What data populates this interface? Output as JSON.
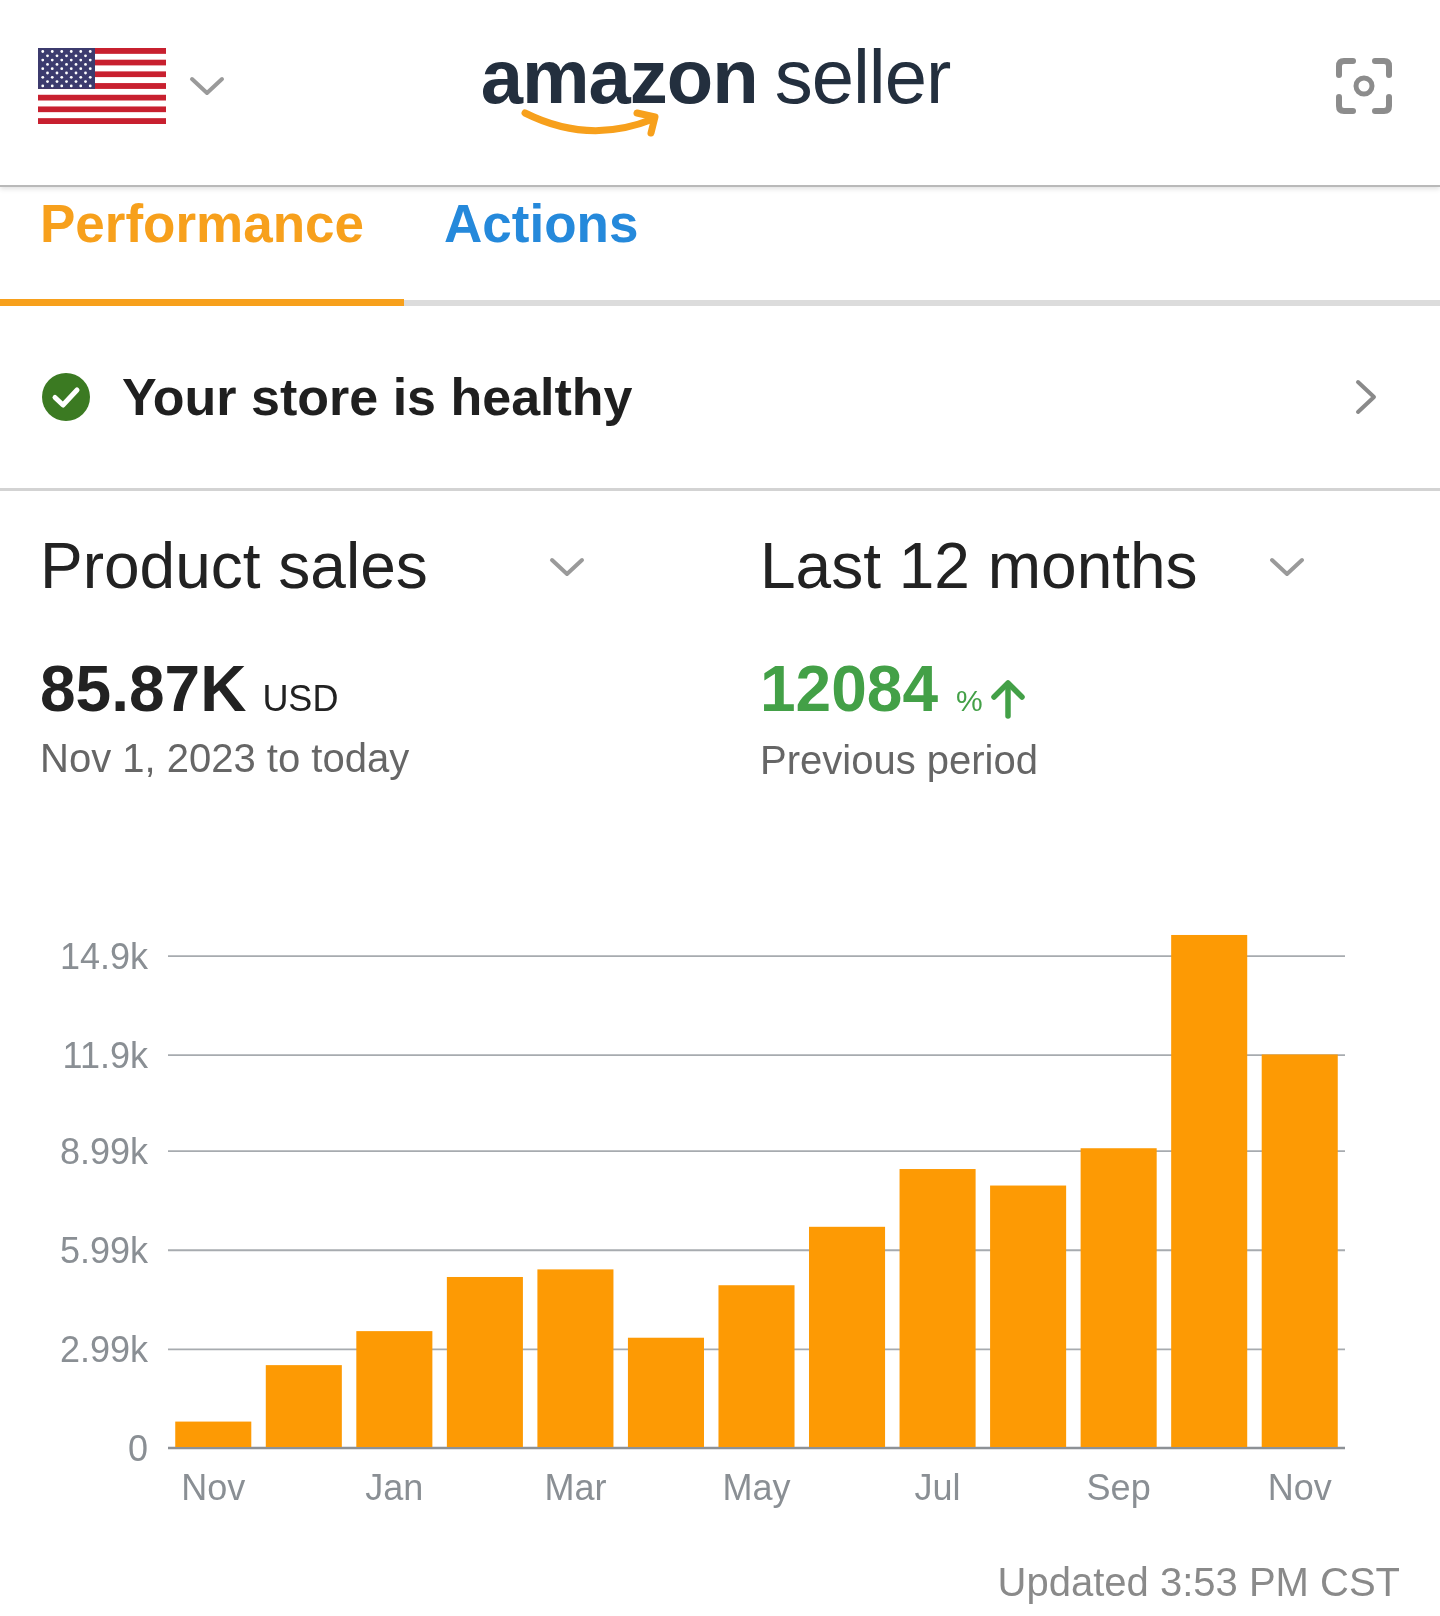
{
  "header": {
    "logo": {
      "brand": "amazon",
      "product": "seller"
    }
  },
  "tabs": [
    {
      "label": "Performance",
      "selected": true
    },
    {
      "label": "Actions",
      "selected": false
    }
  ],
  "store_status": {
    "text": "Your store is healthy",
    "healthy": true
  },
  "metric_selector": {
    "label": "Product sales"
  },
  "period_selector": {
    "label": "Last 12 months"
  },
  "summary": {
    "value": "85.87K",
    "unit": "USD",
    "range": "Nov 1, 2023 to today"
  },
  "comparison": {
    "value": "12084",
    "unit": "%",
    "increase": true,
    "caption": "Previous period"
  },
  "chart": {
    "chart_data": {
      "type": "bar",
      "categories": [
        "Nov",
        null,
        "Jan",
        null,
        "Mar",
        null,
        "May",
        null,
        "Jul",
        null,
        "Sep",
        null,
        "Nov"
      ],
      "values": [
        770,
        2480,
        3510,
        5150,
        5380,
        3310,
        4900,
        6670,
        8420,
        7920,
        9050,
        15510,
        11890
      ],
      "ylim": [
        0,
        15600
      ],
      "yticks": [
        0,
        {
          "value": 2990,
          "label": "2.99k"
        },
        {
          "value": 5990,
          "label": "5.99k"
        },
        {
          "value": 8990,
          "label": "8.99k"
        },
        {
          "value": 11900,
          "label": "11.9k"
        },
        {
          "value": 14900,
          "label": "14.9k"
        }
      ],
      "grid": true
    }
  },
  "updated": "Updated 3:53 PM CST"
}
